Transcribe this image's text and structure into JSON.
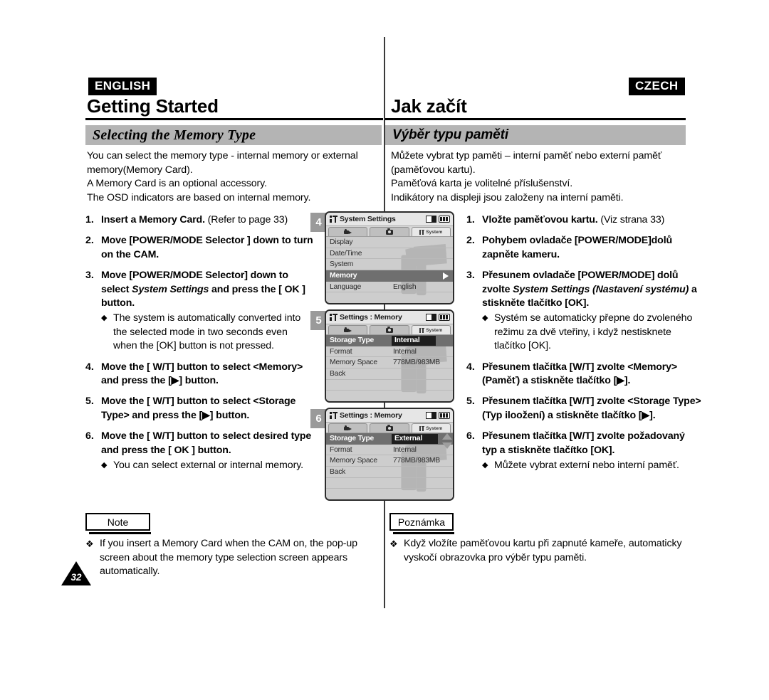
{
  "page": {
    "number": "32"
  },
  "left": {
    "language_badge": "ENGLISH",
    "chapter_title": "Getting Started",
    "section_title": "Selecting the Memory Type",
    "intro": "You can select the memory type - internal memory or external\nmemory(Memory Card).\nA Memory Card is an optional accessory.\nThe OSD indicators are based on internal memory.",
    "steps": [
      {
        "num": "1.",
        "bold": "Insert a Memory Card.",
        "regular": " (Refer to page 33)",
        "sub": []
      },
      {
        "num": "2.",
        "bold": "Move [POWER/MODE Selector ] down to turn on the CAM.",
        "regular": "",
        "sub": []
      },
      {
        "num": "3.",
        "bold_pre": "Move [POWER/MODE Selector] down to select ",
        "italic": "System Settings",
        "bold_post": " and press the [ OK ] button.",
        "sub": [
          "The system is automatically converted into the selected mode in two seconds even when the [OK] button is not pressed."
        ]
      },
      {
        "num": "4.",
        "bold": "Move the [ W/T] button to select <Memory> and press the [▶] button.",
        "regular": "",
        "sub": []
      },
      {
        "num": "5.",
        "bold": "Move the [ W/T] button to select <Storage Type> and press the [▶] button.",
        "regular": "",
        "sub": []
      },
      {
        "num": "6.",
        "bold": "Move the [ W/T] button to select desired type and press the [ OK ] button.",
        "regular": "",
        "sub": [
          "You can select external or internal memory."
        ]
      }
    ],
    "note_label": "Note",
    "note_bullet": "❖",
    "note_text": "If you insert a Memory Card when the CAM on, the pop-up screen about the memory type selection screen appears automatically."
  },
  "right": {
    "language_badge": "CZECH",
    "chapter_title": "Jak začít",
    "section_title": "Výběr typu paměti",
    "intro": "Můžete vybrat typ paměti – interní paměť nebo externí paměť\n(paměťovou kartu).\nPaměťová karta je volitelné příslušenství.\nIndikátory na displeji jsou založeny na interní paměti.",
    "steps": [
      {
        "num": "1.",
        "bold": "Vložte paměťovou kartu.",
        "regular": " (Viz strana 33)",
        "sub": []
      },
      {
        "num": "2.",
        "bold": "Pohybem ovladače [POWER/MODE]dolů zapněte kameru.",
        "regular": "",
        "sub": []
      },
      {
        "num": "3.",
        "bold_pre": "Přesunem ovladače [POWER/MODE] dolů zvolte ",
        "italic": "System Settings (Nastavení systému)",
        "bold_post": " a stiskněte tlačítko [OK].",
        "sub": [
          "Systém se automaticky přepne do zvoleného režimu za dvě vteřiny, i když nestisknete tlačítko [OK]."
        ]
      },
      {
        "num": "4.",
        "bold": "Přesunem tlačítka [W/T] zvolte <Memory> (Paměť) a stiskněte tlačítko [▶].",
        "regular": "",
        "sub": []
      },
      {
        "num": "5.",
        "bold": "Přesunem tlačítka [W/T] zvolte <Storage Type> (Typ iloožení) a stiskněte tlačítko [▶].",
        "regular": "",
        "sub": []
      },
      {
        "num": "6.",
        "bold": "Přesunem tlačítka [W/T] zvolte požadovaný typ a stiskněte tlačítko [OK].",
        "regular": "",
        "sub": [
          "Můžete vybrat externí nebo interní paměť."
        ]
      }
    ],
    "note_label": "Poznámka",
    "note_bullet": "❖",
    "note_text": "Když vložíte paměťovou kartu při zapnuté kameře, automaticky vyskočí obrazovka pro výběr typu paměti."
  },
  "lcd_screens": [
    {
      "step_number": "4",
      "title": "System Settings",
      "tabs": [
        {
          "label": "",
          "icon": "video-camera-icon",
          "active": false
        },
        {
          "label": "",
          "icon": "photo-camera-icon",
          "active": false
        },
        {
          "label": "System",
          "icon": "system-settings-icon",
          "active": true
        }
      ],
      "rows": [
        {
          "label": "Display",
          "value": "",
          "selected": false
        },
        {
          "label": "Date/Time",
          "value": "",
          "selected": false
        },
        {
          "label": "System",
          "value": "",
          "selected": false
        },
        {
          "label": "Memory",
          "value": "",
          "selected": true,
          "arrow": true
        },
        {
          "label": "Language",
          "value": "English",
          "selected": false
        },
        {
          "label": "",
          "value": "",
          "selected": false
        }
      ],
      "scroll_arrows": false
    },
    {
      "step_number": "5",
      "title": "Settings : Memory",
      "tabs": [
        {
          "label": "",
          "icon": "video-camera-icon",
          "active": false
        },
        {
          "label": "",
          "icon": "photo-camera-icon",
          "active": false
        },
        {
          "label": "System",
          "icon": "system-settings-icon",
          "active": true
        }
      ],
      "rows": [
        {
          "label": "Storage Type",
          "value": "Internal",
          "selected": true,
          "arrow": false
        },
        {
          "label": "Format",
          "value": "Internal",
          "selected": false
        },
        {
          "label": "Memory Space",
          "value": "778MB/983MB",
          "selected": false
        },
        {
          "label": "Back",
          "value": "",
          "selected": false
        },
        {
          "label": "",
          "value": "",
          "selected": false
        },
        {
          "label": "",
          "value": "",
          "selected": false
        }
      ],
      "scroll_arrows": false
    },
    {
      "step_number": "6",
      "title": "Settings : Memory",
      "tabs": [
        {
          "label": "",
          "icon": "video-camera-icon",
          "active": false
        },
        {
          "label": "",
          "icon": "photo-camera-icon",
          "active": false
        },
        {
          "label": "System",
          "icon": "system-settings-icon",
          "active": true
        }
      ],
      "rows": [
        {
          "label": "Storage Type",
          "value": "External",
          "selected": true,
          "arrow": false
        },
        {
          "label": "Format",
          "value": "Internal",
          "selected": false
        },
        {
          "label": "Memory Space",
          "value": "778MB/983MB",
          "selected": false
        },
        {
          "label": "Back",
          "value": "",
          "selected": false
        },
        {
          "label": "",
          "value": "",
          "selected": false
        },
        {
          "label": "",
          "value": "",
          "selected": false
        }
      ],
      "scroll_arrows": true
    }
  ],
  "colors": {
    "section_bar": "#b4b4b4",
    "lcd_background": "#cdcdcd",
    "lcd_selected_row": "#6f6f6f",
    "lcd_value_box": "#1e1e1e",
    "step_chip": "#9a9a9a",
    "text": "#000000"
  }
}
